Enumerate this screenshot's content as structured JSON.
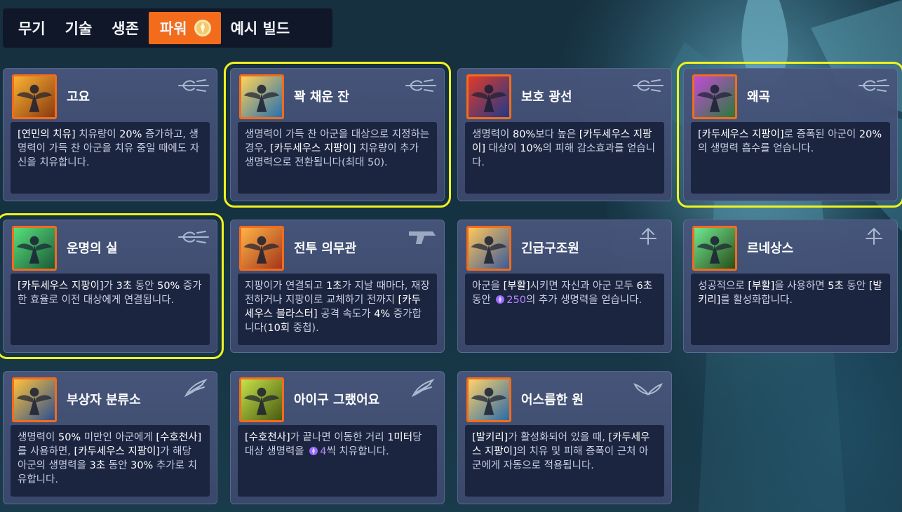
{
  "tabs": [
    {
      "label": "무기",
      "active": false
    },
    {
      "label": "기술",
      "active": false
    },
    {
      "label": "생존",
      "active": false
    },
    {
      "label": "파워",
      "active": true
    },
    {
      "label": "예시 빌드",
      "active": false
    }
  ],
  "colors": {
    "accent": "#f36c1c",
    "highlight": "#f2f21f",
    "card_bg": "#48567c",
    "desc_bg": "#1c2540",
    "desc_text": "#c7cde0",
    "orb": "#9a6bff"
  },
  "cards": [
    {
      "title": "고요",
      "type_icon": "staff-icon",
      "highlighted": false,
      "desc": [
        {
          "k": "[연민의 치유]"
        },
        {
          "t": " 치유량이 "
        },
        {
          "k": "20%"
        },
        {
          "t": " 증가하고, 생명력이 가득 찬 아군을 치유 중일 때에도 자신을 치유합니다."
        }
      ]
    },
    {
      "title": "꽉 채운 잔",
      "type_icon": "staff-icon",
      "highlighted": true,
      "desc": [
        {
          "t": "생명력이 가득 찬 아군을 대상으로 지정하는 경우, "
        },
        {
          "k": "[카두세우스 지팡이]"
        },
        {
          "t": " 치유량이 추가 생명력으로 전환됩니다(최대 50)."
        }
      ]
    },
    {
      "title": "보호 광선",
      "type_icon": "staff-icon",
      "highlighted": false,
      "desc": [
        {
          "t": "생명력이 "
        },
        {
          "k": "80%"
        },
        {
          "t": "보다 높은 "
        },
        {
          "k": "[카두세우스 지팡이]"
        },
        {
          "t": " 대상이 "
        },
        {
          "k": "10%"
        },
        {
          "t": "의 피해 감소효과를 얻습니다."
        }
      ]
    },
    {
      "title": "왜곡",
      "type_icon": "staff-icon",
      "highlighted": true,
      "desc": [
        {
          "k": "[카두세우스 지팡이]"
        },
        {
          "t": "로 증폭된 아군이 "
        },
        {
          "k": "20%"
        },
        {
          "t": "의 생명력 흡수를 얻습니다."
        }
      ]
    },
    {
      "title": "운명의 실",
      "type_icon": "staff-icon",
      "highlighted": true,
      "desc": [
        {
          "k": "[카두세우스 지팡이]"
        },
        {
          "t": "가 "
        },
        {
          "k": "3초"
        },
        {
          "t": " 동안 "
        },
        {
          "k": "50%"
        },
        {
          "t": " 증가한 효율로 이전 대상에게 연결됩니다."
        }
      ]
    },
    {
      "title": "전투 의무관",
      "type_icon": "blaster-icon",
      "highlighted": false,
      "desc": [
        {
          "t": "지팡이가 연결되고 "
        },
        {
          "k": "1초"
        },
        {
          "t": "가 지날 때마다, 재장전하거나 지팡이로 교체하기 전까지 "
        },
        {
          "k": "[카두세우스 블라스터]"
        },
        {
          "t": " 공격 속도가 "
        },
        {
          "k": "4%"
        },
        {
          "t": " 증가합니다("
        },
        {
          "k": "10회"
        },
        {
          "t": " 중첩)."
        }
      ]
    },
    {
      "title": "긴급구조원",
      "type_icon": "resurrect-icon",
      "highlighted": false,
      "desc": [
        {
          "t": "아군을 "
        },
        {
          "k": "[부활]"
        },
        {
          "t": "시키면 자신과 아군 모두 "
        },
        {
          "k": "6초"
        },
        {
          "t": " 동안 "
        },
        {
          "orb": true
        },
        {
          "p": "250"
        },
        {
          "t": "의 추가 생명력을 얻습니다."
        }
      ]
    },
    {
      "title": "르네상스",
      "type_icon": "resurrect-icon",
      "highlighted": false,
      "desc": [
        {
          "t": "성공적으로 "
        },
        {
          "k": "[부활]"
        },
        {
          "t": "을 사용하면 "
        },
        {
          "k": "5초"
        },
        {
          "t": " 동안 "
        },
        {
          "k": "[발키리]"
        },
        {
          "t": "를 활성화합니다."
        }
      ]
    },
    {
      "title": "부상자 분류소",
      "type_icon": "wing-icon",
      "highlighted": false,
      "desc": [
        {
          "t": "생명력이 "
        },
        {
          "k": "50%"
        },
        {
          "t": " 미만인 아군에게 "
        },
        {
          "k": "[수호천사]"
        },
        {
          "t": "를 사용하면, "
        },
        {
          "k": "[카두세우스 지팡이]"
        },
        {
          "t": "가 해당 아군의 생명력을 "
        },
        {
          "k": "3초"
        },
        {
          "t": " 동안 "
        },
        {
          "k": "30%"
        },
        {
          "t": " 추가로 치유합니다."
        }
      ]
    },
    {
      "title": "아이구 그랬어요",
      "type_icon": "wing-icon",
      "highlighted": false,
      "desc": [
        {
          "k": "[수호천사]"
        },
        {
          "t": "가 끝나면 이동한 거리 "
        },
        {
          "k": "1미터"
        },
        {
          "t": "당 대상 생명력을 "
        },
        {
          "orb": true
        },
        {
          "p": "4"
        },
        {
          "t": "씩 치유합니다."
        }
      ]
    },
    {
      "title": "어스름한 원",
      "type_icon": "wings-icon",
      "highlighted": false,
      "desc": [
        {
          "k": "[발키리]"
        },
        {
          "t": "가 활성화되어 있을 때, "
        },
        {
          "k": "[카두세우스 지팡이]"
        },
        {
          "t": "의 치유 및 피해 증폭이 근처 아군에게 자동으로 적용됩니다."
        }
      ]
    }
  ]
}
